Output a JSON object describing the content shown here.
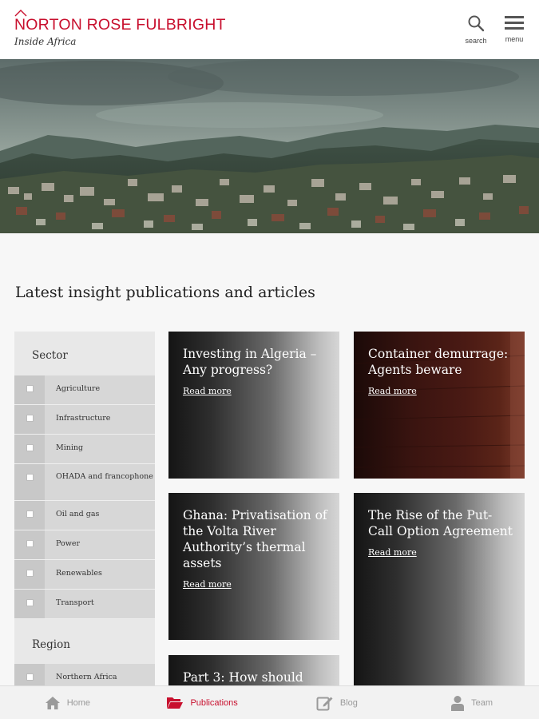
{
  "header": {
    "brand": "NORTON ROSE FULBRIGHT",
    "subtitle": "Inside Africa",
    "search_label": "search",
    "menu_label": "menu"
  },
  "main": {
    "section_title": "Latest insight publications and articles"
  },
  "filters": {
    "sector_heading": "Sector",
    "sectors": [
      {
        "label": "Agriculture",
        "checked": false
      },
      {
        "label": "Infrastructure",
        "checked": false
      },
      {
        "label": "Mining",
        "checked": false
      },
      {
        "label": "OHADA and francophone",
        "checked": false
      },
      {
        "label": "Oil and gas",
        "checked": false
      },
      {
        "label": "Power",
        "checked": false
      },
      {
        "label": "Renewables",
        "checked": false
      },
      {
        "label": "Transport",
        "checked": false
      }
    ],
    "region_heading": "Region",
    "regions": [
      {
        "label": "Northern Africa",
        "checked": false
      }
    ]
  },
  "articles": [
    {
      "title": "Investing in Algeria – Any progress?",
      "link": "Read more"
    },
    {
      "title": "Container demurrage: Agents beware",
      "link": "Read more"
    },
    {
      "title": "Ghana: Privatisation of the Volta River Authority’s thermal assets",
      "link": "Read more"
    },
    {
      "title": "The Rise of the Put-Call Option Agreement",
      "link": "Read more"
    },
    {
      "title": "Part 3: How should",
      "link": ""
    }
  ],
  "nav": {
    "items": [
      {
        "label": "Home",
        "icon": "home-icon",
        "active": false
      },
      {
        "label": "Publications",
        "icon": "folder-icon",
        "active": true
      },
      {
        "label": "Blog",
        "icon": "edit-icon",
        "active": false
      },
      {
        "label": "Team",
        "icon": "person-icon",
        "active": false
      }
    ]
  },
  "colors": {
    "brand_red": "#c8102e",
    "nav_inactive": "#9a9a9a"
  }
}
